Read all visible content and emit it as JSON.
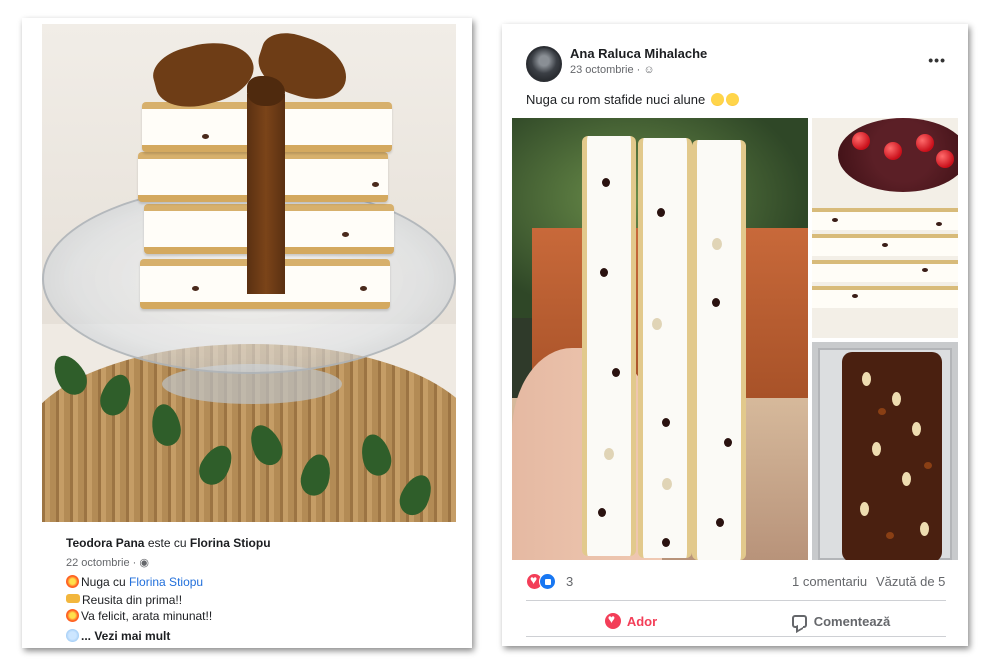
{
  "left_post": {
    "author": "Teodora Pana",
    "with_text": "este cu",
    "tagged": "Florina Stiopu",
    "date": "22 octombrie",
    "line1_prefix": "Nuga cu",
    "line1_tag": "Florina Stiopu",
    "line2": "Reusita din prima!!",
    "line3": "Va felicit, arata minunat!!",
    "see_more": "... Vezi mai mult",
    "icons": [
      "collision-emoji",
      "pointing-hand-emoji",
      "collision-emoji",
      "snowflake-emoji",
      "globe-icon"
    ]
  },
  "right_post": {
    "author": "Ana Raluca Mihalache",
    "date": "23 octombrie",
    "menu": "•••",
    "text": "Nuga cu rom stafide nuci alune",
    "reaction_count": "3",
    "comments": "1 comentariu",
    "views": "Văzută de 5",
    "actions": {
      "love": "Ador",
      "comment": "Comentează"
    }
  },
  "colors": {
    "facebook_blue": "#1877f2",
    "love_red": "#f33e58",
    "secondary_text": "#65676b"
  }
}
